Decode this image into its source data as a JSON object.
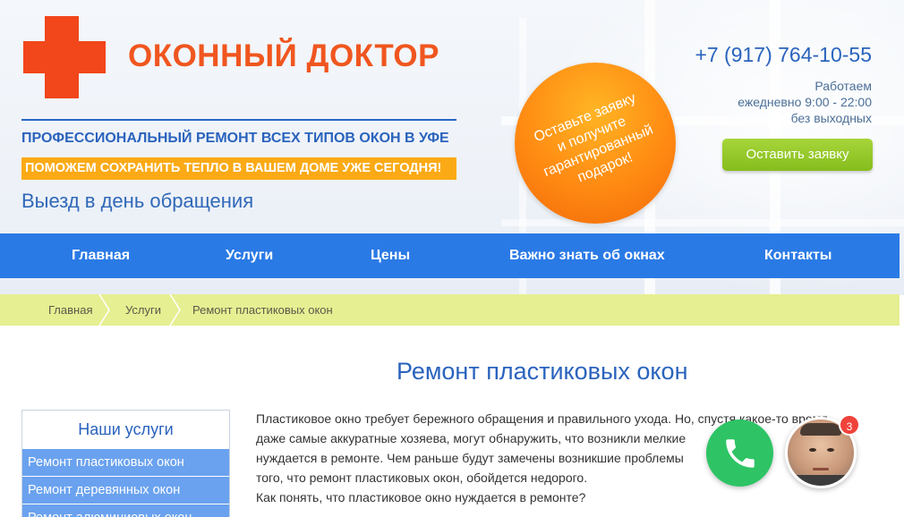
{
  "brand": {
    "name": "ОКОННЫЙ ДОКТОР",
    "tagline": "ПРОФЕССИОНАЛЬНЫЙ РЕМОНТ ВСЕХ ТИПОВ ОКОН В УФЕ",
    "promo": "ПОМОЖЕМ СОХРАНИТЬ ТЕПЛО В ВАШЕМ ДОМЕ УЖЕ СЕГОДНЯ!",
    "visit": "Выезд в день обращения",
    "logo_color": "#f2461b"
  },
  "offer_circle": {
    "text": "Оставьте заявку\nи получите\nгарантированный\nподарок!"
  },
  "contact": {
    "phone": "+7 (917) 764-10-55",
    "hours_line1": "Работаем",
    "hours_line2": "ежедневно 9:00 - 22:00",
    "hours_line3": "без выходных",
    "cta_label": "Оставить заявку"
  },
  "nav": {
    "items": [
      {
        "label": "Главная"
      },
      {
        "label": "Услуги"
      },
      {
        "label": "Цены"
      },
      {
        "label": "Важно знать об окнах"
      },
      {
        "label": "Контакты"
      }
    ]
  },
  "breadcrumb": {
    "items": [
      {
        "label": "Главная"
      },
      {
        "label": "Услуги"
      },
      {
        "label": "Ремонт пластиковых окон"
      }
    ]
  },
  "main": {
    "title": "Ремонт пластиковых окон",
    "paragraph_lines": [
      "Пластиковое окно требует бережного обращения и правильного ухода. Но, спустя какое-то время,",
      "даже самые аккуратные хозяева, могут обнаружить, что возникли мелкие",
      "нуждается в ремонте. Чем раньше будут замечены возникшие проблемы",
      "того, что ремонт пластиковых окон, обойдется недорого.",
      "Как понять, что пластиковое окно нуждается в ремонте?"
    ]
  },
  "sidebar": {
    "title": "Наши услуги",
    "items": [
      {
        "label": "Ремонт пластиковых окон"
      },
      {
        "label": "Ремонт деревянных окон"
      },
      {
        "label": "Ремонт алюминиевых окон"
      }
    ]
  },
  "widgets": {
    "call_icon": "phone-icon",
    "chat_badge": "3"
  }
}
